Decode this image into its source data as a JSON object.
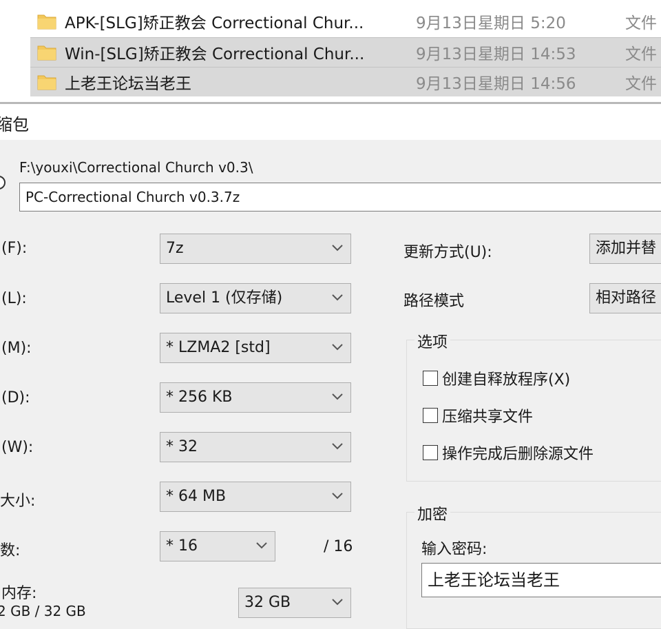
{
  "explorer": {
    "files": [
      {
        "name": "APK-[SLG]矫正教会  Correctional Chur...",
        "date": "9月13日星期日 5:20",
        "type": "文件"
      },
      {
        "name": "Win-[SLG]矫正教会  Correctional Chur...",
        "date": "9月13日星期日 14:53",
        "type": "文件"
      },
      {
        "name": "上老王论坛当老王",
        "date": "9月13日星期日 14:56",
        "type": "文件"
      }
    ]
  },
  "dialog": {
    "title": "缩包",
    "archive_path": "F:\\youxi\\Correctional Church  v0.3\\",
    "archive_name": "PC-Correctional Church  v0.3.7z",
    "format_label": "(F):",
    "format_value": "7z",
    "level_label": "(L):",
    "level_value": "Level 1 (仅存储)",
    "method_label": "(M):",
    "method_value": "* LZMA2 [std]",
    "dict_label": "(D):",
    "dict_value": "* 256 KB",
    "word_label": "(W):",
    "word_value": "* 32",
    "solid_label": "大小:",
    "solid_value": "* 64 MB",
    "threads_label": "数:",
    "threads_value": "* 16",
    "threads_max": "/ 16",
    "memory_label": "内存:",
    "memory_usage": "2 GB / 32 GB",
    "memory_value": "32 GB",
    "update_label": "更新方式(U):",
    "update_value": "添加并替",
    "path_mode_label": "路径模式",
    "path_mode_value": "相对路径",
    "options_title": "选项",
    "options": [
      {
        "label": "创建自释放程序(X)",
        "checked": false
      },
      {
        "label": "压缩共享文件",
        "checked": false
      },
      {
        "label": "操作完成后删除源文件",
        "checked": false
      }
    ],
    "encryption_title": "加密",
    "password_label": "输入密码:",
    "password_value": "上老王论坛当老王"
  },
  "icons": {
    "folder": "folder-icon",
    "dropdown": "chevron-down-icon"
  },
  "colors": {
    "folder_yellow": "#f3c85a",
    "selection": "#d9d9d9",
    "dialog_bg": "#f0f0f0"
  }
}
